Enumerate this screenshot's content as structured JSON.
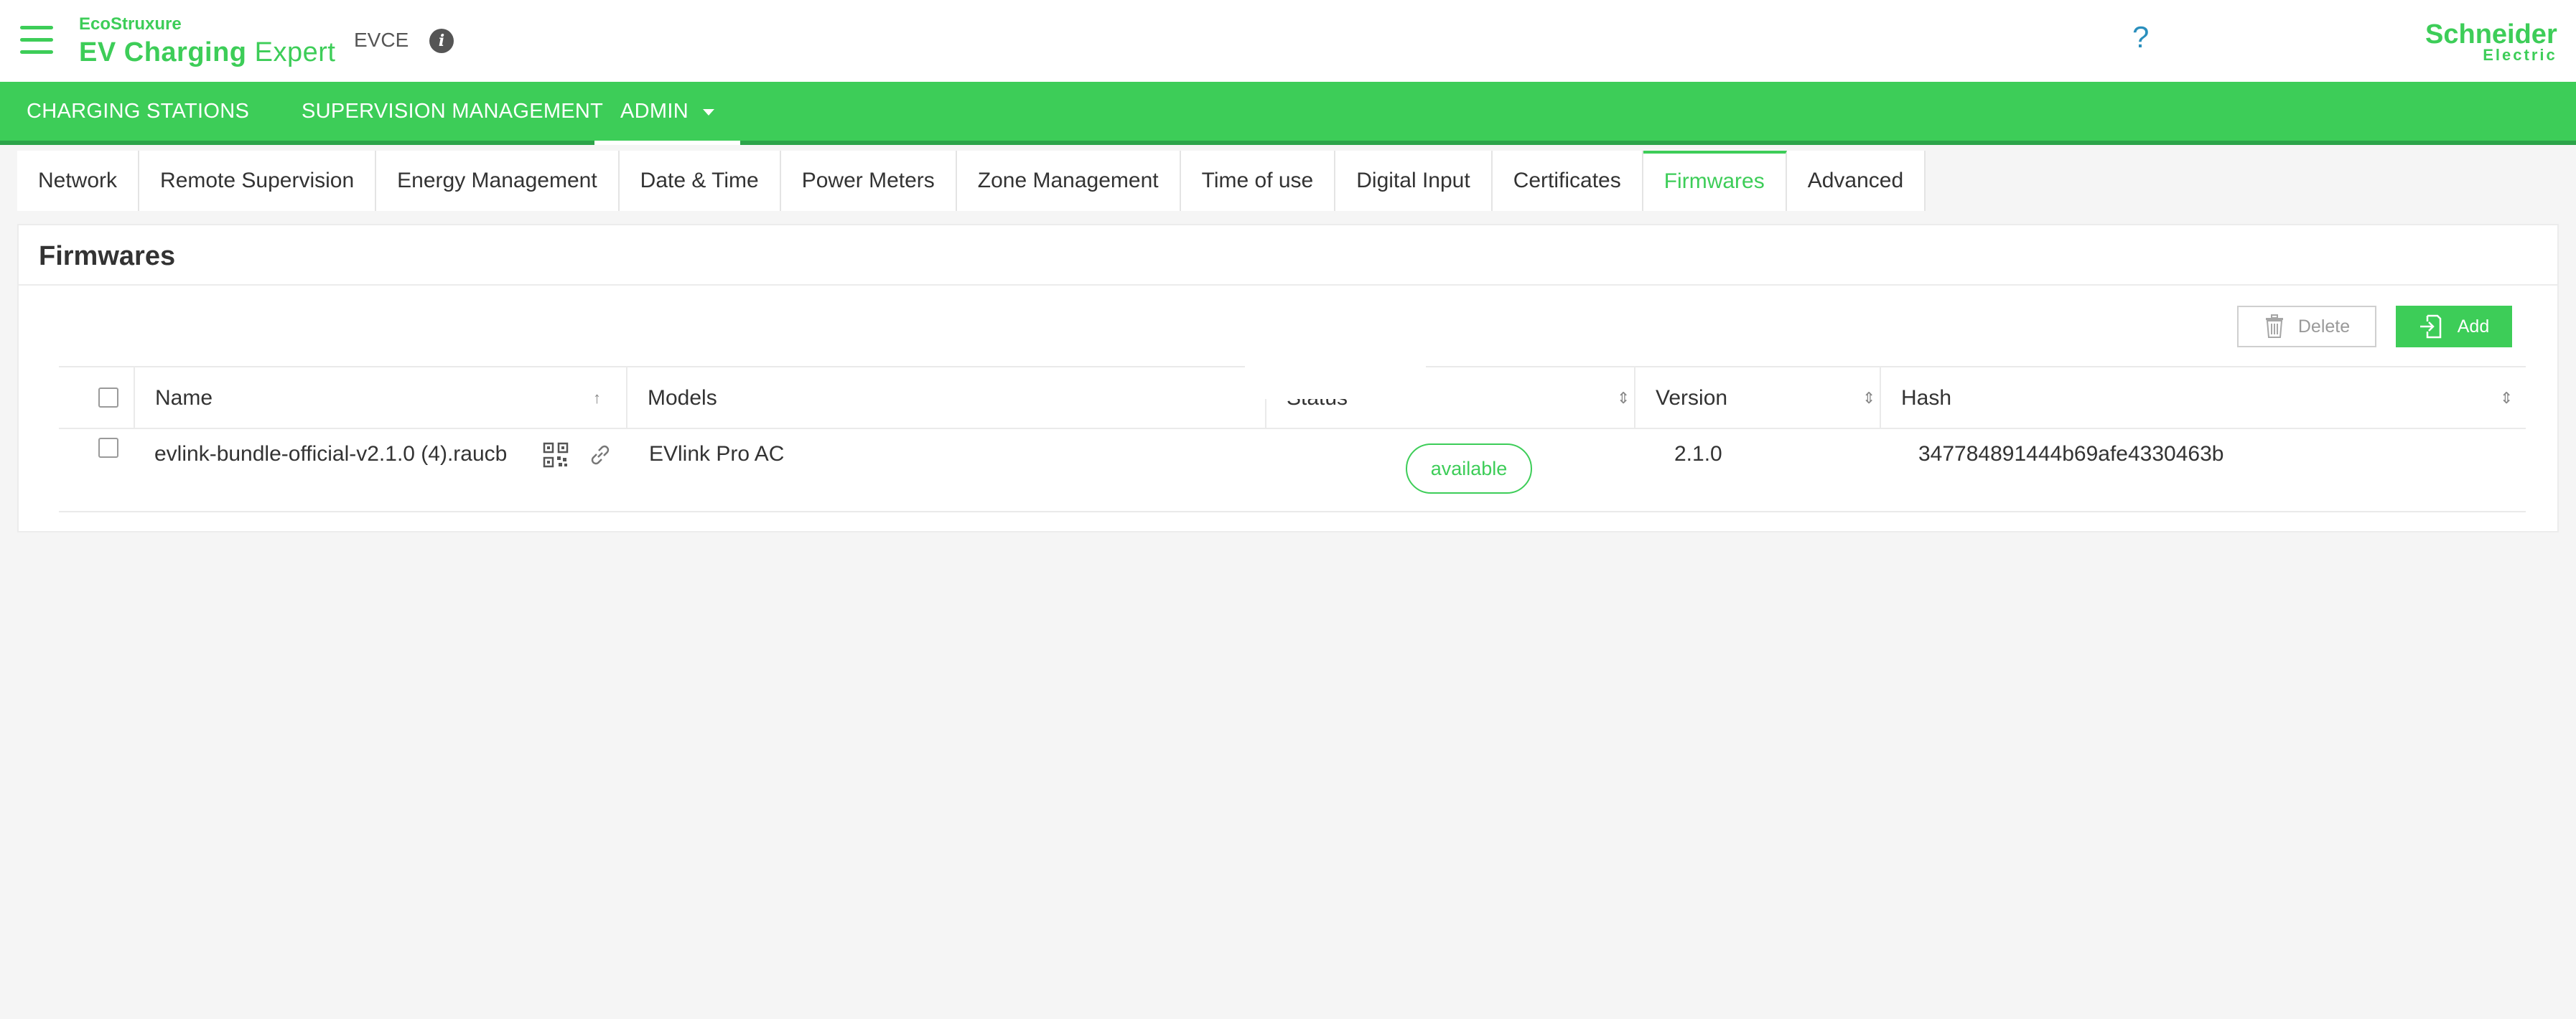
{
  "header": {
    "brand_eco": "EcoStruxure",
    "brand_title_bold": "EV Charging",
    "brand_title_light": "Expert",
    "app_code": "EVCE",
    "help_label": "?",
    "logo_line1": "Schneider",
    "logo_line2": "Electric"
  },
  "main_nav": {
    "items": [
      {
        "label": "CHARGING STATIONS"
      },
      {
        "label": "SUPERVISION MANAGEMENT"
      },
      {
        "label": "ADMIN"
      }
    ]
  },
  "sub_tabs": [
    {
      "label": "Network"
    },
    {
      "label": "Remote Supervision"
    },
    {
      "label": "Energy Management"
    },
    {
      "label": "Date & Time"
    },
    {
      "label": "Power Meters"
    },
    {
      "label": "Zone Management"
    },
    {
      "label": "Time of use"
    },
    {
      "label": "Digital Input"
    },
    {
      "label": "Certificates"
    },
    {
      "label": "Firmwares"
    },
    {
      "label": "Advanced"
    }
  ],
  "active_sub_tab": "Firmwares",
  "panel": {
    "title": "Firmwares",
    "delete_label": "Delete",
    "add_label": "Add"
  },
  "table": {
    "columns": {
      "name": "Name",
      "models": "Models",
      "status": "Status",
      "version": "Version",
      "hash": "Hash"
    },
    "rows": [
      {
        "name": "evlink-bundle-official-v2.1.0 (4).raucb",
        "models": "EVlink Pro AC",
        "status": "available",
        "version": "2.1.0",
        "hash": "347784891444b69afe4330463b"
      }
    ]
  },
  "colors": {
    "brand_green": "#3dcd58",
    "nav_border": "#2da44a",
    "help_blue": "#2a8fbd"
  }
}
